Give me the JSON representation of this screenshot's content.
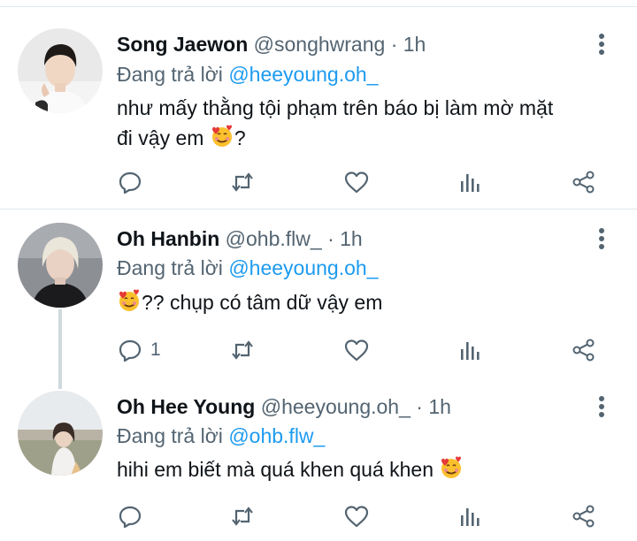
{
  "tweets": [
    {
      "display_name": "Song Jaewon",
      "handle": "@songhwrang",
      "separator": "·",
      "time": "1h",
      "reply_prefix": "Đang trả lời",
      "reply_to": "@heeyoung.oh_",
      "text_line1": "như mấy thằng tội phạm trên báo bị làm mờ mặt",
      "text_line2": "đi vậy em",
      "text_line2_suffix": "?",
      "reply_count": "",
      "emoji": "smiling-face-with-hearts"
    },
    {
      "display_name": "Oh Hanbin",
      "handle": "@ohb.flw_",
      "separator": "·",
      "time": "1h",
      "reply_prefix": "Đang trả lời",
      "reply_to": "@heeyoung.oh_",
      "text_after_emoji": "?? chụp có tâm dữ vậy em",
      "reply_count": "1",
      "emoji": "smiling-face-with-hearts"
    },
    {
      "display_name": "Oh Hee Young",
      "handle": "@heeyoung.oh_",
      "separator": "·",
      "time": "1h",
      "reply_prefix": "Đang trả lời",
      "reply_to": "@ohb.flw_",
      "text": "hihi em biết mà quá khen quá khen",
      "reply_count": "",
      "emoji": "smiling-face-with-hearts"
    }
  ],
  "colors": {
    "accent": "#1d9bf0",
    "secondary_text": "#536471",
    "icon": "#536471",
    "divider": "#e1e8ed"
  },
  "icons": [
    "reply-icon",
    "retweet-icon",
    "like-icon",
    "analytics-icon",
    "share-icon",
    "more-icon"
  ]
}
